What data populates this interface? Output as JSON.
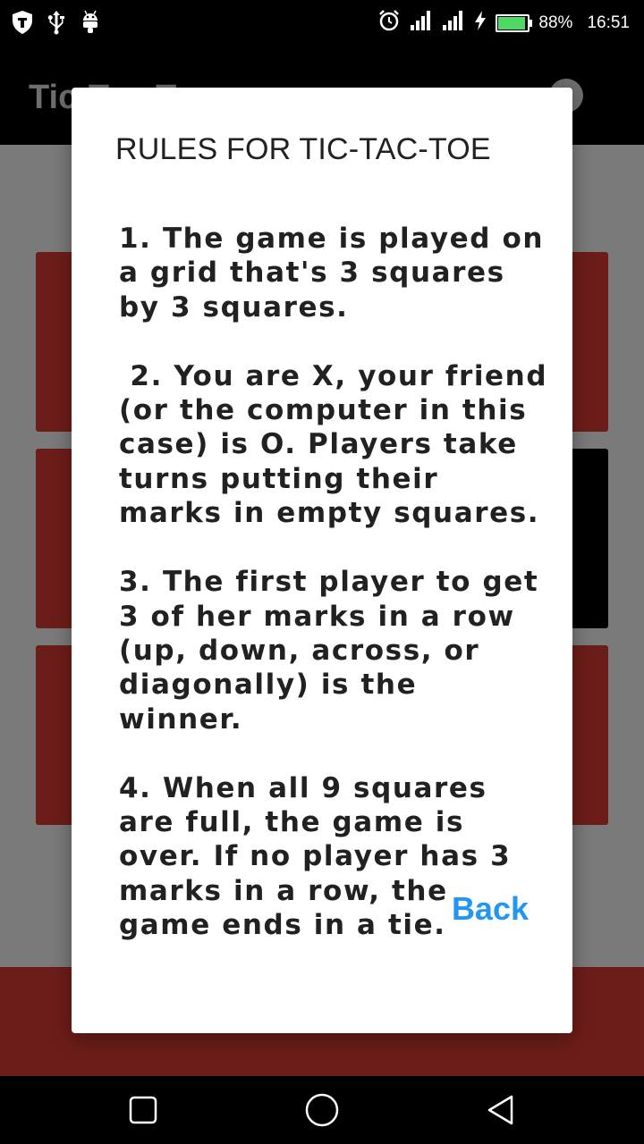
{
  "status_bar": {
    "battery_percent_text": "88%",
    "battery_level": 0.88,
    "time": "16:51",
    "icons_left": [
      "shield-icon",
      "usb-icon",
      "android-icon"
    ],
    "icons_right": [
      "alarm-icon",
      "signal-icon",
      "signal-icon",
      "charging-icon",
      "battery-icon"
    ]
  },
  "app_bar": {
    "title": "Tic-Tac-Toe",
    "help_icon": "help-icon"
  },
  "board": {
    "cells": [
      "red",
      "black",
      "red",
      "red",
      "black",
      "black",
      "red",
      "red",
      "red"
    ]
  },
  "dialog": {
    "title": "RULES FOR TIC-TAC-TOE",
    "rules": [
      "1. The game is played on a grid that's 3 squares by 3 squares.",
      " 2. You are X, your friend (or the computer in this case) is O. Players take turns putting their marks in empty squares.",
      "3. The first player to get 3 of her marks in a row (up, down, across, or diagonally) is the winner.",
      "4. When all 9 squares are full, the game is over. If no player has 3 marks in a row, the game ends in a tie."
    ],
    "back_label": "Back"
  },
  "colors": {
    "accent": "#2196f3",
    "cell_red": "#6d1d19",
    "cell_black": "#000000",
    "scrim": "#7a7a7a"
  },
  "nav_bar": {
    "buttons": [
      "recents-icon",
      "home-icon",
      "back-icon"
    ]
  }
}
